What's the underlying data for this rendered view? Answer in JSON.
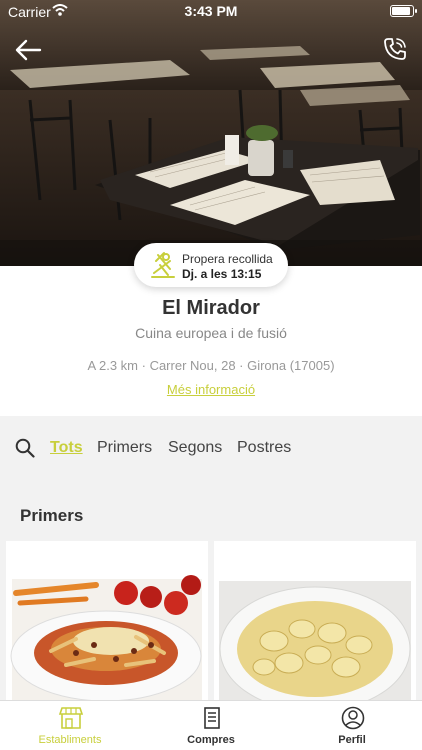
{
  "status_bar": {
    "carrier": "Carrier",
    "time": "3:43 PM"
  },
  "pickup": {
    "label": "Propera recollida",
    "value": "Dj. a les 13:15"
  },
  "restaurant": {
    "name": "El Mirador",
    "cuisine": "Cuina europea i de fusió",
    "address": "A 2.3 km · Carrer Nou, 28 · Girona (17005)",
    "more_info": "Més informació"
  },
  "filters": {
    "tabs": [
      "Tots",
      "Primers",
      "Segons",
      "Postres"
    ],
    "active": "Tots"
  },
  "section": {
    "title": "Primers"
  },
  "tabbar": {
    "items": [
      "Establiments",
      "Compres",
      "Perfil"
    ],
    "active": "Establiments"
  },
  "colors": {
    "accent": "#c8cf3c"
  }
}
